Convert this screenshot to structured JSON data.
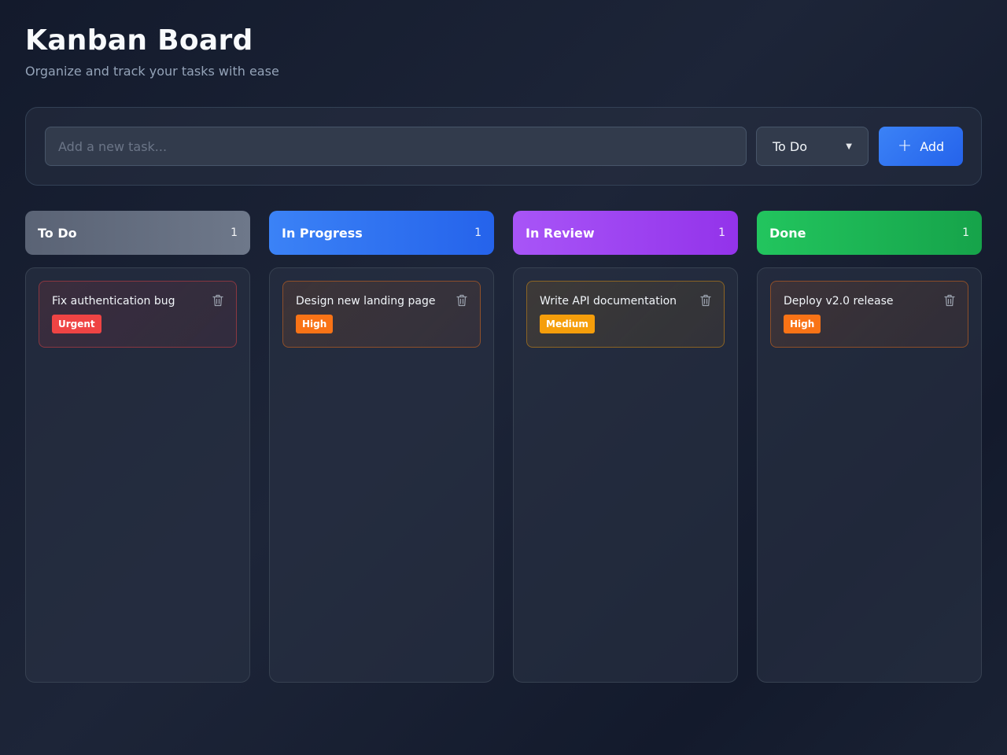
{
  "header": {
    "title": "Kanban Board",
    "subtitle": "Organize and track your tasks with ease"
  },
  "new_task": {
    "placeholder": "Add a new task...",
    "value": "",
    "column_select": "To Do",
    "add_label": "Add"
  },
  "columns": [
    {
      "title": "To Do",
      "count": "1",
      "header_colors": [
        "#5a6375",
        "#6e788a"
      ],
      "cards": [
        {
          "title": "Fix authentication bug",
          "priority": "Urgent",
          "priority_color": "#ef4444"
        }
      ]
    },
    {
      "title": "In Progress",
      "count": "1",
      "header_colors": [
        "#3b82f6",
        "#2563eb"
      ],
      "cards": [
        {
          "title": "Design new landing page",
          "priority": "High",
          "priority_color": "#f97316"
        }
      ]
    },
    {
      "title": "In Review",
      "count": "1",
      "header_colors": [
        "#a855f7",
        "#9333ea"
      ],
      "cards": [
        {
          "title": "Write API documentation",
          "priority": "Medium",
          "priority_color": "#f59e0b"
        }
      ]
    },
    {
      "title": "Done",
      "count": "1",
      "header_colors": [
        "#22c55e",
        "#16a34a"
      ],
      "cards": [
        {
          "title": "Deploy v2.0 release",
          "priority": "High",
          "priority_color": "#f97316"
        }
      ]
    }
  ],
  "icons": {
    "delete": "trash-icon",
    "add": "plus-icon",
    "dropdown": "chevron-down-icon"
  }
}
